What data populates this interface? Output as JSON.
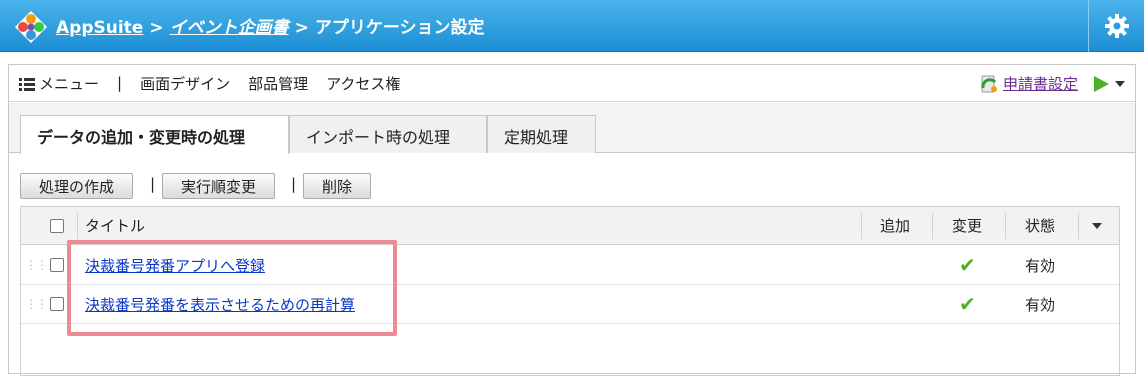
{
  "header": {
    "app": "AppSuite",
    "sep": ">",
    "app_name": "イベント企画書",
    "page": "アプリケーション設定"
  },
  "menu": {
    "items": [
      "メニュー",
      "|",
      "画面デザイン",
      "部品管理",
      "アクセス権"
    ],
    "form_settings": "申請書設定"
  },
  "tabs": [
    "データの追加・変更時の処理",
    "インポート時の処理",
    "定期処理"
  ],
  "toolbar": {
    "create": "処理の作成",
    "reorder": "実行順変更",
    "delete": "削除",
    "sep": "|"
  },
  "table": {
    "headers": {
      "title": "タイトル",
      "add": "追加",
      "change": "変更",
      "status": "状態"
    },
    "rows": [
      {
        "title": "決裁番号発番アプリへ登録",
        "add": "",
        "change": "✔",
        "status": "有効"
      },
      {
        "title": "決裁番号発番を表示させるための再計算",
        "add": "",
        "change": "✔",
        "status": "有効"
      }
    ]
  },
  "colors": {
    "header_blue": "#2a9ee0",
    "check_green": "#4caf2a",
    "highlight": "#ee8a93"
  }
}
